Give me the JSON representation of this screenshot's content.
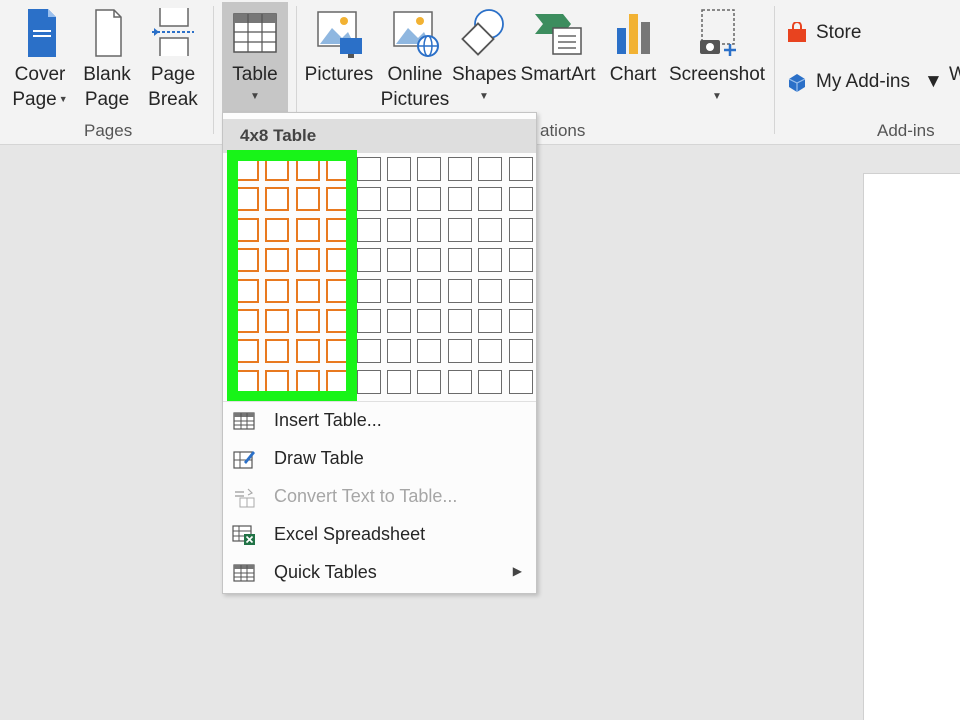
{
  "ribbon": {
    "pages_group": {
      "label": "Pages",
      "cover_page": {
        "line1": "Cover",
        "line2": "Page"
      },
      "blank_page": {
        "line1": "Blank",
        "line2": "Page"
      },
      "page_break": {
        "line1": "Page",
        "line2": "Break"
      }
    },
    "table_button": {
      "label": "Table"
    },
    "illustrations_group": {
      "label_partial": "ations",
      "pictures": {
        "label": "Pictures"
      },
      "online_pictures": {
        "line1": "Online",
        "line2": "Pictures"
      },
      "shapes": {
        "label": "Shapes"
      },
      "smartart": {
        "label": "SmartArt"
      },
      "chart": {
        "label": "Chart"
      },
      "screenshot": {
        "label": "Screenshot"
      }
    },
    "addins_group": {
      "label": "Add-ins",
      "store": {
        "label": "Store"
      },
      "my_addins": {
        "label": "My Add-ins"
      },
      "cut_off_letter": "W"
    }
  },
  "table_menu": {
    "title": "4x8 Table",
    "grid": {
      "columns": 10,
      "rows": 8,
      "selected_columns": 4,
      "selected_rows": 8
    },
    "items": [
      {
        "label": "Insert Table...",
        "icon": "table-insert-icon",
        "enabled": true
      },
      {
        "label": "Draw Table",
        "icon": "draw-table-icon",
        "enabled": true
      },
      {
        "label": "Convert Text to Table...",
        "icon": "convert-text-icon",
        "enabled": false
      },
      {
        "label": "Excel Spreadsheet",
        "icon": "excel-icon",
        "enabled": true
      },
      {
        "label": "Quick Tables",
        "icon": "quick-tables-icon",
        "enabled": true,
        "submenu": true
      }
    ]
  },
  "colors": {
    "highlight": "#18f418",
    "selected_cell": "#e8791f",
    "ribbon_bg": "#f3f3f3",
    "workspace_bg": "#e6e6e6"
  }
}
